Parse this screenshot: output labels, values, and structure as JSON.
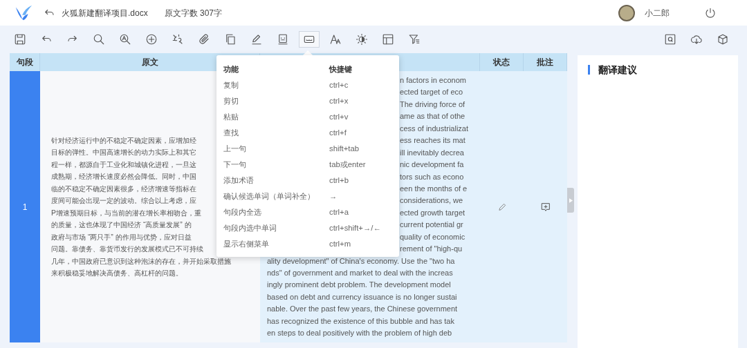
{
  "header": {
    "title": "火狐新建翻译项目.docx",
    "word_count": "原文字数 307字",
    "user_name": "小二郎"
  },
  "toolbar": {
    "items": [
      {
        "kind": "save",
        "selected": false
      },
      {
        "kind": "undo",
        "selected": false
      },
      {
        "kind": "redo",
        "selected": false
      },
      {
        "kind": "search",
        "selected": false
      },
      {
        "kind": "text-search",
        "selected": false
      },
      {
        "kind": "add",
        "selected": false
      },
      {
        "kind": "unlink",
        "selected": false
      },
      {
        "kind": "attach",
        "selected": false
      },
      {
        "kind": "copy",
        "selected": false
      },
      {
        "kind": "pencil",
        "selected": false
      },
      {
        "kind": "face",
        "selected": false
      },
      {
        "kind": "keyboard",
        "selected": true
      },
      {
        "kind": "font",
        "selected": false
      },
      {
        "kind": "brightness",
        "selected": false
      },
      {
        "kind": "layout",
        "selected": false
      },
      {
        "kind": "filter",
        "selected": false
      }
    ],
    "right_items": [
      {
        "kind": "search-box"
      },
      {
        "kind": "cloud"
      },
      {
        "kind": "cube"
      }
    ]
  },
  "table": {
    "columns": {
      "segment": "句段",
      "source": "原文",
      "status": "状态",
      "comment": "批注"
    },
    "rows": [
      {
        "number": "1",
        "selected": true,
        "source_lines": [
          "针对经济运行中的不稳定不确定因素，应增加经",
          "目标的弹性。中国高速增长的动力实际上和其它",
          "程一样，都源自于工业化和城镇化进程，一旦这",
          "成熟期，经济增长速度必然会降低。同时，中国",
          "临的不稳定不确定因素很多，经济增速等指标在",
          "度间可能会出现一定的波动。综合以上考虑，应",
          "P增速预期目标，与当前的潜在增长率相吻合，重",
          "的质量，这也体现了中国经济 “高质量发展” 的",
          "政府与市场 “两只手” 的作用与优势，应对日益",
          "问题。靠债务、靠货币发行的发展模式已不可持续",
          "几年，中国政府已意识到这种泡沫的存在，并开始采取措施",
          "来积极稳妥地解决高债务、高杠杆的问题。"
        ],
        "target_lines_beside_menu": [
          "n factors in econom",
          "ected target of eco",
          "The driving force of",
          "ame as that of othe",
          "cess of industrializat",
          "ess reaches its mat",
          "ill inevitably decrea",
          "nic development fa",
          "tors such as econo",
          "een the months of e",
          "considerations, we",
          "ected growth target",
          "current potential gr",
          "quality of economic",
          "rement of \"high-qu"
        ],
        "target_lines": [
          "ality development\" of China's economy. Use the \"two ha",
          "nds\" of government and market to deal with the increas",
          "ingly prominent debt problem. The development model",
          "based on debt and currency issuance is no longer sustai",
          "nable. Over the past few years, the Chinese government",
          "has recognized the existence of this bubble and has tak",
          "en steps to deal positively with the problem of high deb"
        ]
      }
    ]
  },
  "shortcut_menu": {
    "headers": [
      "功能",
      "快捷键"
    ],
    "items": [
      {
        "action": "复制",
        "keys": "ctrl+c"
      },
      {
        "action": "剪切",
        "keys": "ctrl+x"
      },
      {
        "action": "粘贴",
        "keys": "ctrl+v"
      },
      {
        "action": "查找",
        "keys": "ctrl+f"
      },
      {
        "action": "上一句",
        "keys": "shift+tab"
      },
      {
        "action": "下一句",
        "keys": "tab或enter"
      },
      {
        "action": "添加术语",
        "keys": "ctrl+b"
      },
      {
        "action": "确认候选单词（单词补全）",
        "keys": "→"
      },
      {
        "action": "句段内全选",
        "keys": "ctrl+a"
      },
      {
        "action": "句段内选中单词",
        "keys": "ctrl+shift+→/←"
      },
      {
        "action": "显示右侧菜单",
        "keys": "ctrl+m"
      }
    ]
  },
  "suggestions_panel": {
    "title": "翻译建议"
  }
}
